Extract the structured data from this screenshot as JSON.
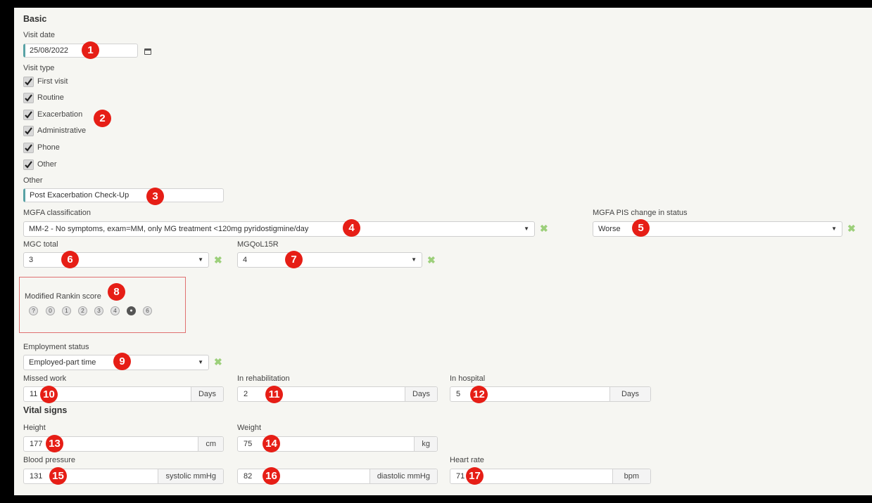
{
  "sections": {
    "basic": "Basic",
    "vital": "Vital signs"
  },
  "visit_date": {
    "label": "Visit date",
    "value": "25/08/2022"
  },
  "visit_type": {
    "label": "Visit type",
    "options": [
      {
        "label": "First visit",
        "checked": true
      },
      {
        "label": "Routine",
        "checked": true
      },
      {
        "label": "Exacerbation",
        "checked": true
      },
      {
        "label": "Administrative",
        "checked": true
      },
      {
        "label": "Phone",
        "checked": true
      },
      {
        "label": "Other",
        "checked": true
      }
    ]
  },
  "other": {
    "label": "Other",
    "value": "Post Exacerbation Check-Up"
  },
  "mgfa": {
    "label": "MGFA classification",
    "value": "MM-2 - No symptoms, exam=MM, only MG treatment <120mg pyridostigmine/day"
  },
  "mgfa_pis": {
    "label": "MGFA PIS change in status",
    "value": "Worse"
  },
  "mgc": {
    "label": "MGC total",
    "value": "3"
  },
  "mgqol": {
    "label": "MGQoL15R",
    "value": "4"
  },
  "rankin": {
    "label": "Modified Rankin score",
    "options": [
      "?",
      "0",
      "1",
      "2",
      "3",
      "4",
      "5",
      "6"
    ],
    "selected": "5"
  },
  "employment": {
    "label": "Employment status",
    "value": "Employed-part time"
  },
  "missed_work": {
    "label": "Missed work",
    "value": "11",
    "unit": "Days"
  },
  "rehab": {
    "label": "In rehabilitation",
    "value": "2",
    "unit": "Days"
  },
  "hospital": {
    "label": "In hospital",
    "value": "5",
    "unit": "Days"
  },
  "height": {
    "label": "Height",
    "value": "177",
    "unit": "cm"
  },
  "weight": {
    "label": "Weight",
    "value": "75",
    "unit": "kg"
  },
  "bp": {
    "label": "Blood pressure",
    "systolic": "131",
    "systolic_unit": "systolic mmHg",
    "diastolic": "82",
    "diastolic_unit": "diastolic mmHg"
  },
  "hr": {
    "label": "Heart rate",
    "value": "71",
    "unit": "bpm"
  },
  "markers": [
    "1",
    "2",
    "3",
    "4",
    "5",
    "6",
    "7",
    "8",
    "9",
    "10",
    "11",
    "12",
    "13",
    "14",
    "15",
    "16",
    "17"
  ],
  "colors": {
    "accent": "#5aa3a6",
    "badge": "#e61e16",
    "clear": "#9ccf7a",
    "highlight_border": "#e07070"
  }
}
